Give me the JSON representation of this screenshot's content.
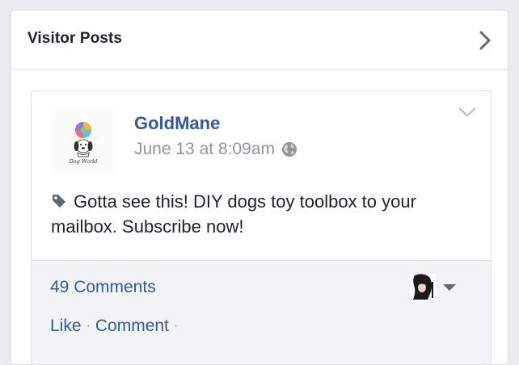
{
  "panel": {
    "title": "Visitor Posts",
    "open_icon": "chevron-right-icon"
  },
  "post": {
    "author": "GoldMane",
    "avatar_logo_text": "Dog World",
    "timestamp": "June 13 at 8:09am",
    "privacy_icon": "globe-icon",
    "menu_icon": "chevron-down-icon",
    "tag_icon": "tag-icon",
    "text": "Gotta see this! DIY dogs toy toolbox to your mailbox. Subscribe now!",
    "comments_count": "49 Comments",
    "actions": {
      "like": "Like",
      "separator": "·",
      "comment": "Comment"
    }
  },
  "colors": {
    "link_blue": "#365899",
    "meta_gray": "#90949c",
    "border": "#dddfe2",
    "page_bg": "#e9ebee",
    "footer_bg": "#f2f3f5"
  }
}
